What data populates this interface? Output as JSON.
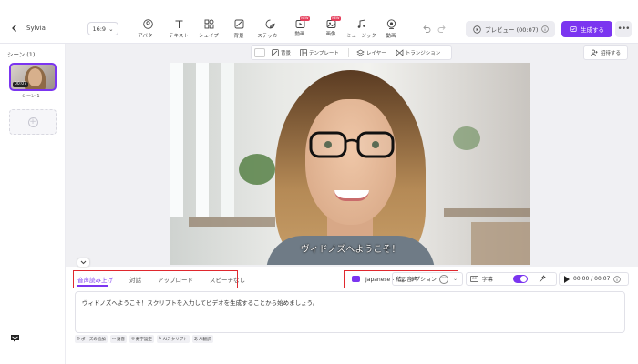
{
  "header": {
    "project_name": "Sylvia",
    "aspect_ratio": "16:9",
    "tools": [
      {
        "label": "アバター",
        "icon": "avatar-icon"
      },
      {
        "label": "テキスト",
        "icon": "text-icon"
      },
      {
        "label": "シェイプ",
        "icon": "shape-icon"
      },
      {
        "label": "背景",
        "icon": "background-icon"
      },
      {
        "label": "ステッカー",
        "icon": "sticker-icon"
      },
      {
        "label": "動画",
        "icon": "video-icon",
        "badge": "NEW"
      },
      {
        "label": "画像",
        "icon": "image-icon",
        "badge": "NEW"
      },
      {
        "label": "ミュージック",
        "icon": "music-icon"
      },
      {
        "label": "動画",
        "icon": "record-icon"
      }
    ],
    "preview_label": "プレビュー (00:07)",
    "generate_label": "生成する",
    "more_label": "•••"
  },
  "sidebar": {
    "scene_header": "シーン (1)",
    "scenes": [
      {
        "label": "シーン 1",
        "duration": "00:07"
      }
    ]
  },
  "canvas_toolbar": {
    "items": [
      "背景",
      "テンプレート",
      "レイヤー",
      "トランジション"
    ],
    "invite_label": "招待する"
  },
  "video": {
    "caption": "ヴィドノズへようこそ！"
  },
  "panel": {
    "tabs": [
      {
        "label": "音声読み上げ",
        "active": true
      },
      {
        "label": "対話",
        "active": false
      },
      {
        "label": "アップロード",
        "active": false
      },
      {
        "label": "スピーチなし",
        "active": false
      }
    ],
    "voice_label": "Japanese - 私の音声",
    "voice_more": "···",
    "option_label": "オプション",
    "subtitle_label": "字幕",
    "cc_label": "CC",
    "subtitle_enabled": true,
    "time_display": "00:00 / 00:07",
    "script_text": "ヴィドノズへようこそ！スクリプトを入力してビデオを生成することから始めましょう。",
    "bottom_tools": [
      {
        "label": "ポーズの追加",
        "icon": "clock-icon"
      },
      {
        "label": "発音",
        "icon": "pronunciation-icon"
      },
      {
        "label": "数字設定",
        "icon": "number-icon"
      },
      {
        "label": "AIスクリプト",
        "icon": "ai-script-icon"
      },
      {
        "label": "AI翻訳",
        "icon": "ai-translate-icon"
      }
    ]
  },
  "colors": {
    "accent": "#7b35f0",
    "highlight_box": "#e0282e",
    "badge": "#e53e5b"
  }
}
